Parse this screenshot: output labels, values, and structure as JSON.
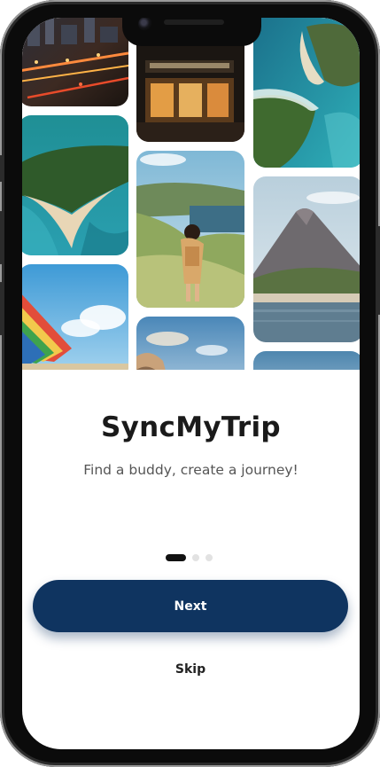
{
  "app": {
    "title": "SyncMyTrip",
    "tagline": "Find a buddy, create a journey!"
  },
  "onboarding": {
    "page_count": 3,
    "active_page": 1
  },
  "actions": {
    "next_label": "Next",
    "skip_label": "Skip"
  },
  "gallery": {
    "photos": [
      {
        "name": "city-night-photo"
      },
      {
        "name": "island-sandbar-photo"
      },
      {
        "name": "beach-banner-photo"
      },
      {
        "name": "cafe-storefront-photo"
      },
      {
        "name": "hiker-coast-photo"
      },
      {
        "name": "cliff-sky-photo"
      },
      {
        "name": "island-lagoon-photo"
      },
      {
        "name": "volcano-lake-photo"
      },
      {
        "name": "sky-photo"
      }
    ]
  },
  "colors": {
    "primary": "#0f3460",
    "dot_active": "#111111",
    "dot_inactive": "#e2e2e2",
    "title": "#1a1a1a",
    "subtitle": "#555555"
  }
}
